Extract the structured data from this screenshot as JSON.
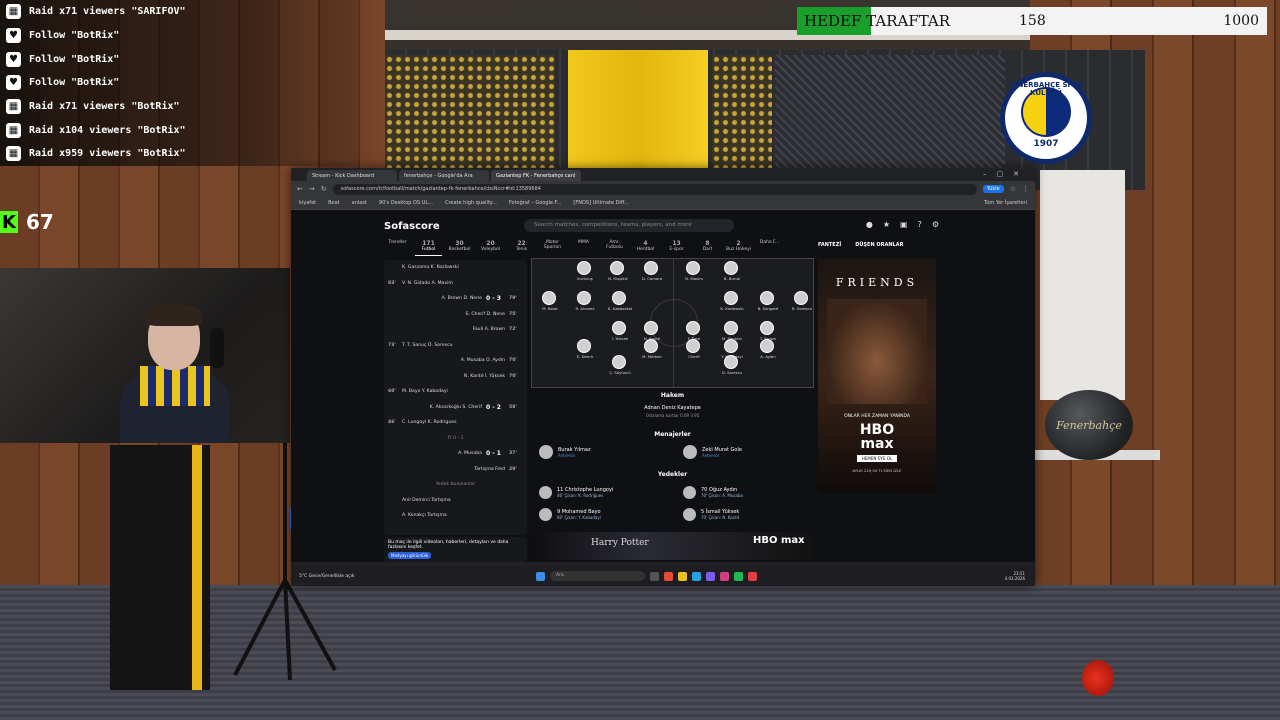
{
  "overlay": {
    "events": [
      {
        "icon": "grid-icon",
        "text": "Raid x71 viewers \"SARIFOV\""
      },
      {
        "icon": "heart-icon",
        "text": "Follow \"BotRix\""
      },
      {
        "icon": "heart-icon",
        "text": "Follow \"BotRix\""
      },
      {
        "icon": "heart-icon",
        "text": "Follow \"BotRix\""
      },
      {
        "icon": "grid-icon",
        "text": "Raid x71 viewers \"BotRix\""
      },
      {
        "icon": "grid-icon",
        "text": "Raid x104 viewers \"BotRix\""
      },
      {
        "icon": "grid-icon",
        "text": "Raid x959 viewers \"BotRix\""
      }
    ],
    "viewer_count": "67",
    "goal": {
      "label": "HEDEF TARAFTAR",
      "current": "158",
      "target": "1000",
      "progress": 0.158,
      "color": "#1a9e2c"
    },
    "club_logo": {
      "top": "FENERBAHÇE SPOR KULÜBÜ",
      "year": "1907"
    },
    "ball_text": "Fenerbahçe"
  },
  "browser": {
    "tabs": [
      "Stream - Kick Dashboard",
      "fenerbahçe - Google'da Ara",
      "Gaziantep FK - Fenerbahçe canl"
    ],
    "url": "sofascore.com/tr/football/match/gaziantep-fk-fenerbahce/cbsNccr#id:13589684",
    "yukle": "Yükle",
    "bookmarks": [
      "kiyafet",
      "Beat",
      "anlast",
      "90's Desktop OS UL...",
      "Create high quality...",
      "Fotoğraf – Google F...",
      "[FNOS] Ultimate Diff..."
    ],
    "bookmarks_right": "Tüm Yer İşaretleri"
  },
  "sofascore": {
    "logo": "Sofascore",
    "search_placeholder": "Search matches, competitions, teams, players, and more",
    "sports": [
      {
        "count": "",
        "label": "Trendler"
      },
      {
        "count": "171",
        "label": "Futbol"
      },
      {
        "count": "30",
        "label": "Basketbol"
      },
      {
        "count": "20",
        "label": "Voleybol"
      },
      {
        "count": "22",
        "label": "Tenis"
      },
      {
        "count": "",
        "label": "Motor Sporları"
      },
      {
        "count": "",
        "label": "MMA"
      },
      {
        "count": "",
        "label": "Amr. Futbolu"
      },
      {
        "count": "4",
        "label": "Hentbol"
      },
      {
        "count": "13",
        "label": "E-spor"
      },
      {
        "count": "8",
        "label": "Dart"
      },
      {
        "count": "2",
        "label": "Buz Hokeyi"
      },
      {
        "count": "",
        "label": "Daha F..."
      }
    ],
    "top_right": [
      "FANTEZİ",
      "DÜŞEN ORANLAR"
    ],
    "events": [
      {
        "min": "",
        "text": "K. Gassama  K. Kozlowski",
        "type": "left"
      },
      {
        "min": "83'",
        "text": "V. N. Gidado  A. Maxim",
        "type": "left"
      },
      {
        "min": "",
        "text": "A. Brown D. Nene",
        "score": "0 - 3",
        "end": "79'",
        "type": "right"
      },
      {
        "min": "",
        "text": "S. Cherif  D. Nene",
        "end": "75'",
        "type": "right"
      },
      {
        "min": "",
        "text": "Fauli  A. Brown",
        "end": "72'",
        "type": "right"
      },
      {
        "min": "73'",
        "text": "T. T. Sanuç  D. Sorescu",
        "type": "left"
      },
      {
        "min": "",
        "text": "A. Musaba  O. Aydın",
        "end": "70'",
        "type": "right"
      },
      {
        "min": "",
        "text": "N. Kanté  İ. Yüksek",
        "end": "70'",
        "type": "right"
      },
      {
        "min": "60'",
        "text": "M. Bayo  Y. Kabadayi",
        "type": "left"
      },
      {
        "min": "",
        "text": "K. Aksarkoğlu  S. Cherif",
        "score": "0 - 2",
        "end": "58'",
        "type": "right"
      },
      {
        "min": "46'",
        "text": "C. Lungoyi  K. Rodrigues",
        "type": "left"
      },
      {
        "min": "",
        "text": "İY 0 - 1",
        "type": "center"
      },
      {
        "min": "",
        "text": "A. Musaba",
        "score": "0 - 1",
        "end": "37'",
        "type": "right"
      },
      {
        "min": "",
        "text": "Tartışma  Fred",
        "end": "29'",
        "type": "right"
      },
      {
        "min": "",
        "text": "Yedek bulunanlar",
        "type": "center"
      },
      {
        "min": "",
        "text": "Anil Demirci  Tartışma",
        "type": "left"
      },
      {
        "min": "",
        "text": "A. Konakçı  Tartışma",
        "type": "left"
      }
    ],
    "players": [
      "N. Mujakić",
      "D. Camara",
      "N. Maxim",
      "B. Buruk",
      "M. Bolat",
      "R. Alvarez",
      "K. Kabasakal",
      "K. Kozlowski",
      "B. Sangaré",
      "B. Sorescu",
      "İ. Yüksek",
      "N. Kanté",
      "F. Fred",
      "M. Skriniar",
      "T. Brown",
      "E. Demir",
      "Ç. Söyüncü",
      "Y. Kabadayi",
      "A. Aydın",
      "D. Sorescu",
      "Cherif",
      "M. Merken",
      "Kurtuluş"
    ],
    "referee": {
      "heading": "Hakem",
      "name": "Adnan Deniz Kayatepe",
      "stats": "Ortalama kartlar  0.09  3.95"
    },
    "managers": {
      "heading": "Menajerler",
      "home": {
        "name": "Burak Yılmaz",
        "role": "Antrenör"
      },
      "away": {
        "name": "Zeki Murat Gole",
        "role": "Antrenör"
      }
    },
    "subs_heading": "Yedekler",
    "subs": [
      {
        "name": "11 Christophe Lungoyi",
        "note": "46' Çıkan: K. Rodrigues"
      },
      {
        "name": "9 Mohamed Bayo",
        "note": "60' Çıkan: Y. Kabadayi"
      },
      {
        "name": "70 Oğuz Aydın",
        "note": "70' Çıkan: A. Musaba"
      },
      {
        "name": "5 İsmail Yüksek",
        "note": "70' Çıkan: N. Kanté"
      }
    ],
    "ad": {
      "title": "FRIENDS",
      "line1": "ONLAR HER ZAMAN YANINDA",
      "brand1": "HBO",
      "brand2": "max",
      "button": "HEMEN ÜYE OL",
      "line2": "AYLIK 229,90 TL'DEN İZLE"
    },
    "promo": {
      "text": "Bu maç ile ilgili videoları, haberleri, detayları ve daha fazlasını keşfet.",
      "button": "Medyayı görüntüle"
    },
    "banner": {
      "title": "Harry Potter",
      "brand": "HBO max"
    }
  },
  "taskbar": {
    "weather": "5°C Gece/Genellikle açık",
    "search": "Ara",
    "time": "23:51",
    "date": "4.03.2026"
  }
}
